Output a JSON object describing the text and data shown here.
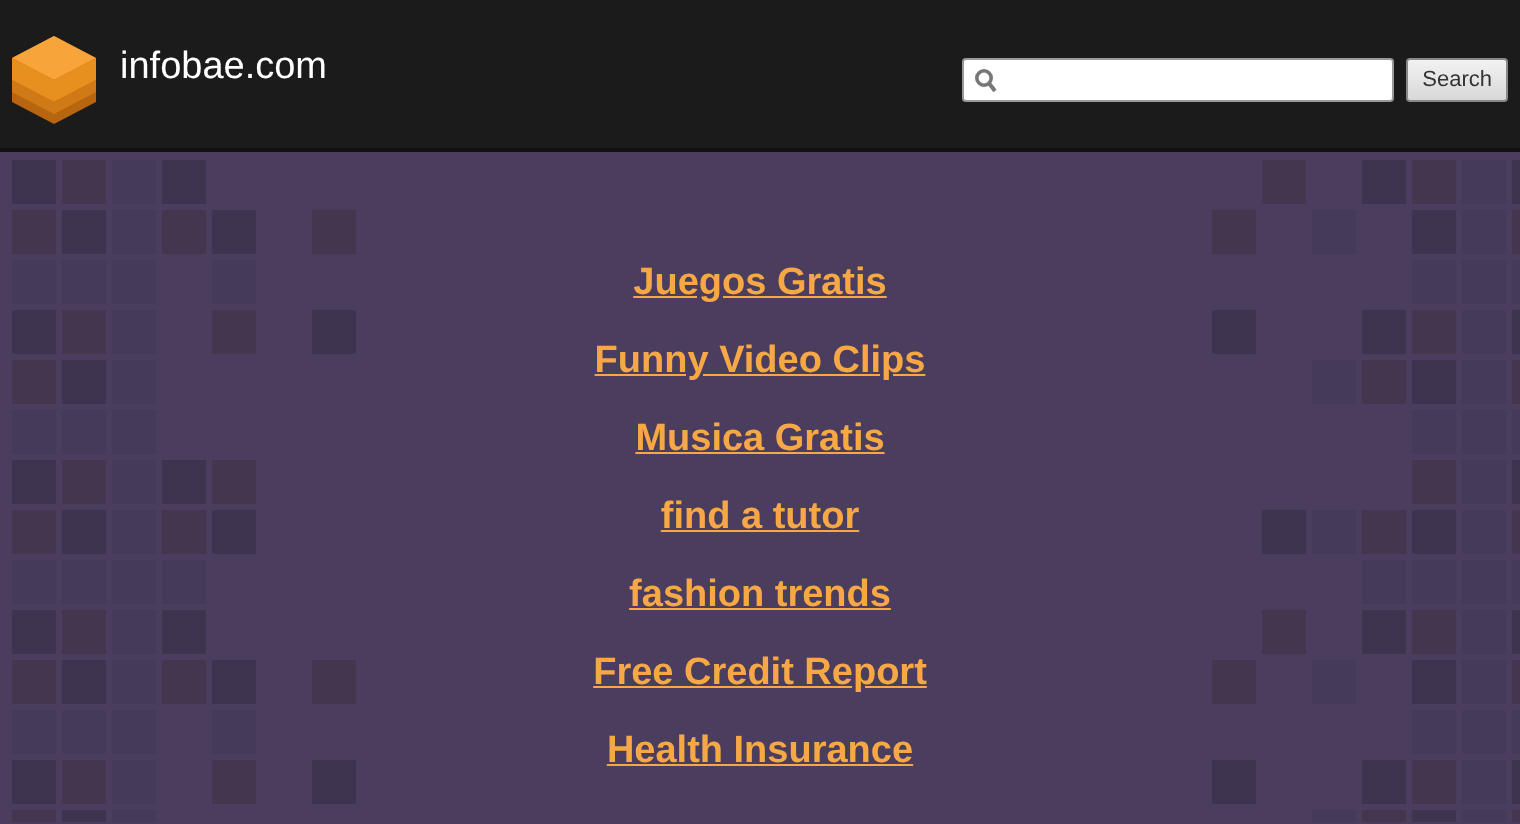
{
  "header": {
    "site_name": "infobae.com",
    "search": {
      "button": "Search"
    }
  },
  "links": [
    "Juegos Gratis",
    "Funny Video Clips",
    "Musica Gratis",
    "find a tutor",
    "fashion trends",
    "Free Credit Report",
    "Health Insurance"
  ]
}
